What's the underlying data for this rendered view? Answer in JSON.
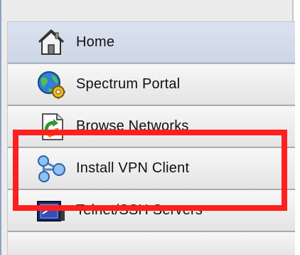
{
  "navigation": {
    "items": [
      {
        "label": "Home",
        "icon": "home-icon"
      },
      {
        "label": "Spectrum Portal",
        "icon": "globe-gear-icon"
      },
      {
        "label": "Browse Networks",
        "icon": "refresh-document-icon"
      },
      {
        "label": "Install VPN Client",
        "icon": "network-nodes-icon"
      },
      {
        "label": "Telnet/SSH Servers",
        "icon": "terminal-icon"
      }
    ]
  },
  "annotation": {
    "highlight_color": "#ff1f1f"
  },
  "colors": {
    "active_background": "#d4dceb",
    "panel_background": "#ececec",
    "sidebar_border": "#8fa3c2"
  }
}
